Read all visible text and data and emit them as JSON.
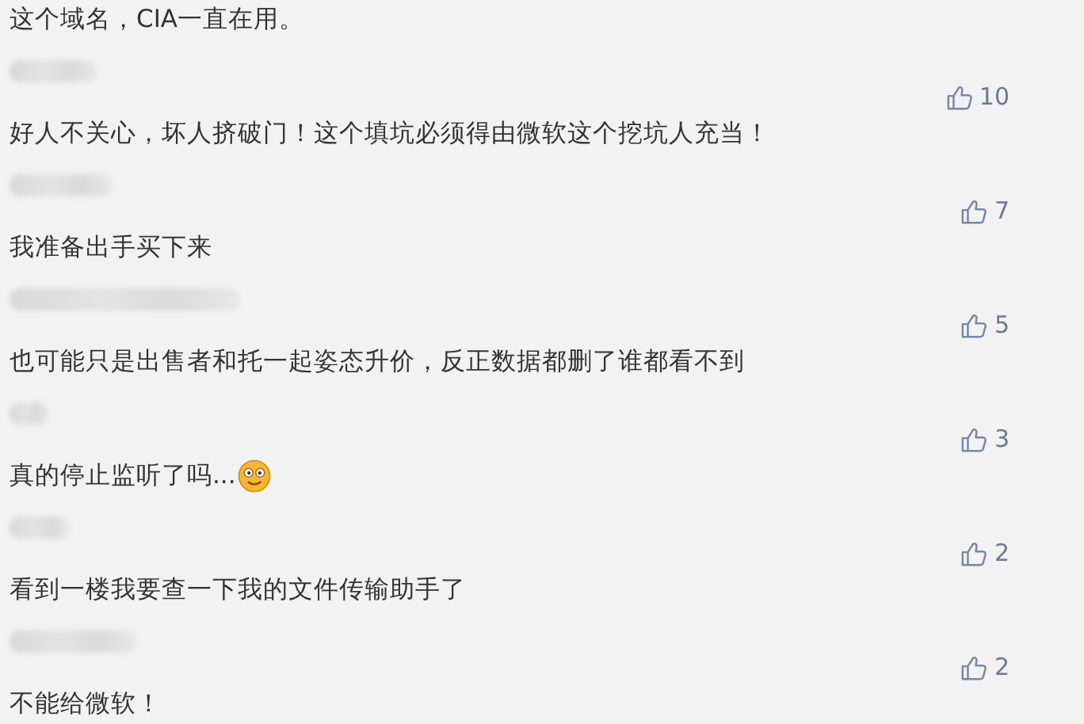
{
  "comments": [
    {
      "text": "这个域名，CIA一直在用。"
    },
    {
      "likes": "10",
      "text": "好人不关心，坏人挤破门！这个填坑必须得由微软这个挖坑人充当！"
    },
    {
      "likes": "7",
      "text": "我准备出手买下来"
    },
    {
      "likes": "5",
      "text": "也可能只是出售者和托一起姿态升价，反正数据都删了谁都看不到"
    },
    {
      "likes": "3",
      "text": "真的停止监听了吗...",
      "emoji": true
    },
    {
      "likes": "2",
      "text": "看到一楼我要查一下我的文件传输助手了"
    },
    {
      "likes": "2",
      "text": "不能给微软！"
    }
  ]
}
